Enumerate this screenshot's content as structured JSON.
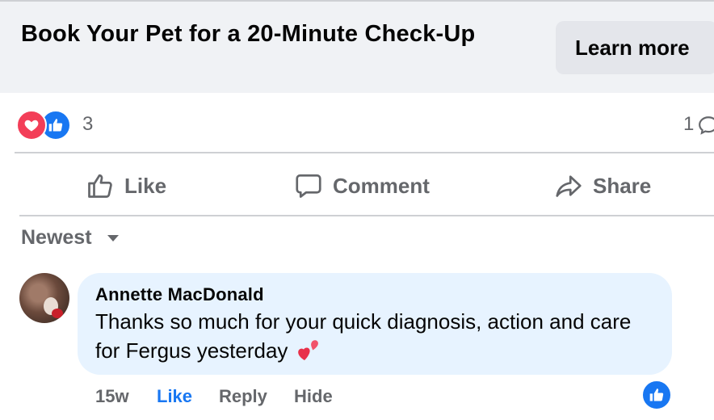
{
  "banner": {
    "title": "Book Your Pet for a 20-Minute Check-Up",
    "cta_label": "Learn more"
  },
  "reactions": {
    "types": [
      "love",
      "like"
    ],
    "count": "3",
    "comment_count": "1"
  },
  "actions": {
    "like": "Like",
    "comment": "Comment",
    "share": "Share"
  },
  "sort": {
    "selected": "Newest"
  },
  "comment": {
    "author": "Annette MacDonald",
    "text": "Thanks so much for your quick diagnosis, action and care for Fergus yesterday",
    "emoji": "two-hearts",
    "time": "15w",
    "like": "Like",
    "reply": "Reply",
    "hide": "Hide",
    "reaction": "like"
  },
  "colors": {
    "accent": "#1877f2",
    "love": "#f33e58",
    "bubble": "#e7f3ff",
    "banner_bg": "#f0f2f5",
    "muted_text": "#65676b"
  }
}
